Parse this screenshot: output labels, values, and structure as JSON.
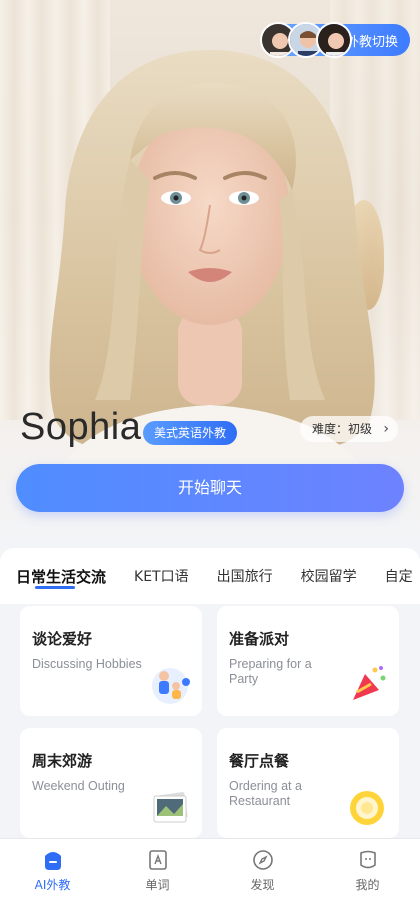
{
  "hero": {
    "teacher_name": "Sophia",
    "teacher_badge": "美式英语外教",
    "level_label": "难度：初级",
    "start_button": "开始聊天",
    "switch_label": "外教切换"
  },
  "tabs": [
    {
      "label": "日常生活交流",
      "active": true
    },
    {
      "label": "KET口语",
      "active": false
    },
    {
      "label": "出国旅行",
      "active": false
    },
    {
      "label": "校园留学",
      "active": false
    },
    {
      "label": "自定",
      "active": false
    }
  ],
  "cards": [
    {
      "title": "谈论爱好",
      "subtitle": "Discussing Hobbies",
      "icon": "hobby-illustration"
    },
    {
      "title": "准备派对",
      "subtitle": "Preparing for a Party",
      "icon": "party-popper-illustration"
    },
    {
      "title": "周末郊游",
      "subtitle": "Weekend Outing",
      "icon": "photos-illustration"
    },
    {
      "title": "餐厅点餐",
      "subtitle": "Ordering at a Restaurant",
      "icon": "plate-illustration"
    }
  ],
  "nav": [
    {
      "label": "AI外教",
      "icon": "ai-teacher-icon",
      "active": true
    },
    {
      "label": "单词",
      "icon": "vocabulary-icon",
      "active": false
    },
    {
      "label": "发现",
      "icon": "compass-icon",
      "active": false
    },
    {
      "label": "我的",
      "icon": "profile-icon",
      "active": false
    }
  ],
  "colors": {
    "accent": "#2f6df5",
    "button_start": "#4f8dff",
    "button_end": "#6d82ff"
  }
}
